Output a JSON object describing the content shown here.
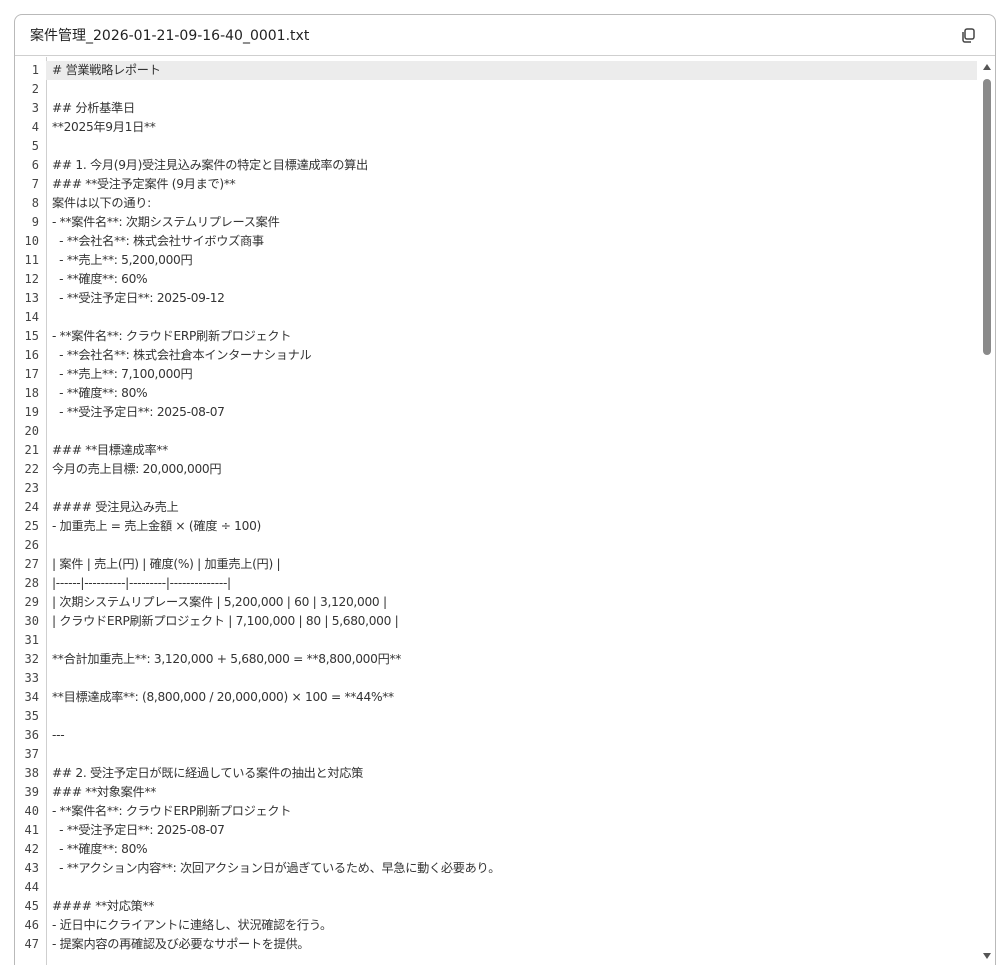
{
  "file": {
    "name": "案件管理_2026-01-21-09-16-40_0001.txt"
  },
  "icons": {
    "copy": "copy-icon",
    "scroll_up": "arrow-up-icon",
    "scroll_down": "arrow-down-icon"
  },
  "lines": [
    "# 営業戦略レポート",
    "",
    "## 分析基準日",
    "**2025年9月1日**",
    "",
    "## 1. 今月(9月)受注見込み案件の特定と目標達成率の算出",
    "### **受注予定案件 (9月まで)**",
    "案件は以下の通り:",
    "- **案件名**: 次期システムリプレース案件",
    "  - **会社名**: 株式会社サイボウズ商事",
    "  - **売上**: 5,200,000円",
    "  - **確度**: 60%",
    "  - **受注予定日**: 2025-09-12",
    "",
    "- **案件名**: クラウドERP刷新プロジェクト",
    "  - **会社名**: 株式会社倉本インターナショナル",
    "  - **売上**: 7,100,000円",
    "  - **確度**: 80%",
    "  - **受注予定日**: 2025-08-07",
    "",
    "### **目標達成率**",
    "今月の売上目標: 20,000,000円",
    "",
    "#### 受注見込み売上",
    "- 加重売上 = 売上金額 × (確度 ÷ 100)",
    "",
    "| 案件 | 売上(円) | 確度(%) | 加重売上(円) |",
    "|------|----------|---------|--------------|",
    "| 次期システムリプレース案件 | 5,200,000 | 60 | 3,120,000 |",
    "| クラウドERP刷新プロジェクト | 7,100,000 | 80 | 5,680,000 |",
    "",
    "**合計加重売上**: 3,120,000 + 5,680,000 = **8,800,000円**",
    "",
    "**目標達成率**: (8,800,000 / 20,000,000) × 100 = **44%**",
    "",
    "---",
    "",
    "## 2. 受注予定日が既に経過している案件の抽出と対応策",
    "### **対象案件**",
    "- **案件名**: クラウドERP刷新プロジェクト",
    "  - **受注予定日**: 2025-08-07",
    "  - **確度**: 80%",
    "  - **アクション内容**: 次回アクション日が過ぎているため、早急に動く必要あり。",
    "",
    "#### **対応策**",
    "- 近日中にクライアントに連絡し、状況確認を行う。",
    "- 提案内容の再確認及び必要なサポートを提供。"
  ]
}
